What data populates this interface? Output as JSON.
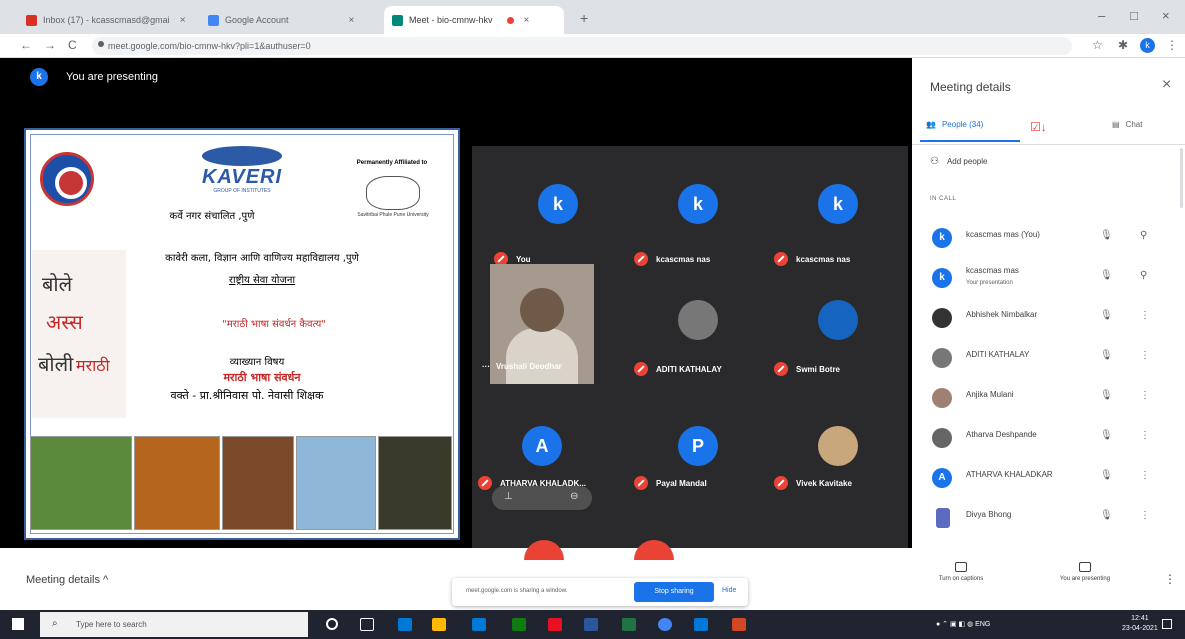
{
  "browser": {
    "tabs": [
      {
        "label": "Inbox (17) - kcasscmasd@gmai",
        "fav_color": "#d93025"
      },
      {
        "label": "Google Account",
        "fav_color": "#4285f4"
      },
      {
        "label": "Meet - bio-cmnw-hkv",
        "fav_color": "#00897b"
      }
    ],
    "new_tab": "+",
    "url": "meet.google.com/bio-cmnw-hkv?pli=1&authuser=0",
    "profile_initial": "k",
    "window_controls": {
      "minimize": "–",
      "maximize": "□",
      "close": "×"
    }
  },
  "meet": {
    "presenting_label": "You are presenting",
    "presenter_initial": "k",
    "slide": {
      "kaveri": "KAVERI",
      "kaveri_sub": "GROUP OF INSTITUTES",
      "affiliated": "Permanently Affiliated to",
      "seal_text": "Savitribai Phule Pune University",
      "line1": "कर्वे नगर संचालित ,पुणे",
      "line2": "कावेरी कला, विज्ञान आणि वाणिज्य महाविद्यालय ,पुणे",
      "line3": "राष्ट्रीय सेवा योजना",
      "line4": "\"मराठी भाषा संवर्धन कैवत्य\"",
      "line5": "व्याख्यान विषय",
      "line6": "मराठी भाषा संवर्धन",
      "line7": "वक्ते - प्रा.श्रीनिवास पो. नेवासी शिक्षक",
      "calligraphy": [
        "बोले",
        "अस्स",
        "बोली",
        "मराठी"
      ]
    },
    "tiles": [
      {
        "initial": "k",
        "name": "You",
        "color": "#1a73e8"
      },
      {
        "initial": "k",
        "name": "kcascmas nas",
        "color": "#1a73e8"
      },
      {
        "initial": "k",
        "name": "kcascmas nas",
        "color": "#1a73e8"
      },
      {
        "initial": "",
        "name": "ADITI KATHALAY",
        "color": "#777777"
      },
      {
        "initial": "",
        "name": "Swmi Botre",
        "color": "#1565c0"
      },
      {
        "initial": "A",
        "name": "ATHARVA KHALADK...",
        "color": "#1a73e8"
      },
      {
        "initial": "P",
        "name": "Payal Mandal",
        "color": "#1a73e8"
      },
      {
        "initial": "",
        "name": "Vivek Kavitake",
        "color": "#c9a77c"
      }
    ],
    "camera_tile_name": "Vrushali Deodhar",
    "camera_tile_prefix": "···",
    "hover_controls": [
      "⊕",
      "⊖"
    ]
  },
  "panel": {
    "title": "Meeting details",
    "close": "×",
    "tab_people": "People (34)",
    "tab_chat": "Chat",
    "add_people": "Add people",
    "in_call": "IN CALL",
    "people": [
      {
        "name": "kcascmas mas (You)",
        "sub": "",
        "initial": "k",
        "color": "#1a73e8",
        "action": "⚲"
      },
      {
        "name": "kcascmas mas",
        "sub": "Your presentation",
        "initial": "k",
        "color": "#1a73e8",
        "action": "⚲"
      },
      {
        "name": "Abhishek Nimbalkar",
        "sub": "",
        "initial": "",
        "color": "#333333",
        "action": "⋮"
      },
      {
        "name": "ADITI KATHALAY",
        "sub": "",
        "initial": "",
        "color": "#777777",
        "action": "⋮"
      },
      {
        "name": "Anjika Mulani",
        "sub": "",
        "initial": "",
        "color": "#a08070",
        "action": "⋮"
      },
      {
        "name": "Atharva Deshpande",
        "sub": "",
        "initial": "",
        "color": "#666666",
        "action": "⋮"
      },
      {
        "name": "ATHARVA KHALADKAR",
        "sub": "",
        "initial": "A",
        "color": "#1a73e8",
        "action": "⋮"
      },
      {
        "name": "Divya Bhong",
        "sub": "",
        "initial": "",
        "color": "#5c6bc0",
        "action": "⋮"
      }
    ],
    "mute_icon": "🔇"
  },
  "bottombar": {
    "meeting_details": "Meeting details ^",
    "share_notice": "meet.google.com is sharing a window.",
    "stop_sharing": "Stop sharing",
    "hide": "Hide",
    "captions": "Turn on captions",
    "presenting": "You are presenting",
    "more": "⋮"
  },
  "taskbar": {
    "search_placeholder": "Type here to search",
    "tray": "ENG",
    "time": "12:41",
    "date": "23-04-2021"
  }
}
